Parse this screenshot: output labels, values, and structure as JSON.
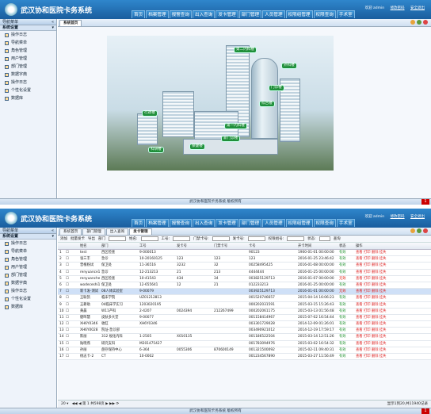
{
  "app": {
    "title": "武汉协和医院卡务系统"
  },
  "nav": [
    "首页",
    "档案管理",
    "报警查询",
    "出入查询",
    "发卡管理",
    "部门管理",
    "人员管理",
    "权限组管理",
    "权限查询",
    "手术室"
  ],
  "user": {
    "welcome": "欢迎 admin",
    "change_pwd": "修改密码",
    "logout": "安全退出"
  },
  "sidebar": {
    "header": "导航菜单",
    "collapse": "«",
    "section": "系统设置",
    "items": [
      "操作日志",
      "导航菜单",
      "角色管理",
      "用户管理",
      "部门管理",
      "数据字典",
      "操作日志",
      "个性化设置",
      "数据库"
    ]
  },
  "screen1": {
    "tabs": [
      "系统首页"
    ],
    "labels": [
      "第二内科楼",
      "外科楼",
      "门诊楼",
      "综合楼",
      "行政楼",
      "第一内科楼",
      "新门诊楼",
      "保健楼",
      "科研楼"
    ]
  },
  "screen2": {
    "tabs": [
      "系统首页",
      "部门管理",
      "出入查询",
      "发卡管理"
    ],
    "toolbar": {
      "add": "添加",
      "edit": "批量发卡",
      "export": "导出",
      "import": "部门",
      "name": "姓名:",
      "id": "工号:",
      "card": "门禁卡号:",
      "issue": "发卡号:",
      "group": "权限组号:",
      "status": "状态:",
      "search": "查询"
    },
    "columns": [
      "",
      "姓名",
      "部门",
      "工号",
      "发卡号",
      "门禁卡号",
      "卡号",
      "开卡时间",
      "状态",
      "操作"
    ],
    "rows": [
      [
        "1",
        "test",
        "西区检查",
        "9-000013",
        "",
        "",
        "90123",
        "1900-01-01 00:00:00",
        "有效"
      ],
      [
        "2",
        "张三丰",
        "急诊",
        "10-20160125",
        "123",
        "123",
        "123",
        "2016-01-25 23:46:42",
        "有效"
      ],
      [
        "3",
        "曾根粉试",
        "保卫处",
        "11-36516",
        "3232",
        "32",
        "00258495425",
        "2016-01-08 00:00:00",
        "有效"
      ],
      [
        "4",
        "renyuance1",
        "急诊",
        "12-213213",
        "21",
        "213",
        "4444444",
        "2016-01-25 00:00:00",
        "有效"
      ],
      [
        "5",
        "renyuancheshi",
        "西区检查",
        "10-41543",
        "434",
        "34",
        "003825129713",
        "2016-01-07 00:00:00",
        "无效"
      ],
      [
        "6",
        "wodeceshi1",
        "保卫处",
        "12-655641",
        "12",
        "21",
        "012233213",
        "2016-01-25 00:00:00",
        "有效"
      ],
      [
        "7",
        "新卡发-测试",
        "08人体实验室",
        "9-00079",
        "",
        "",
        "003925129713",
        "2016-01-01 00:00:00",
        "无效"
      ],
      [
        "8",
        "王联凯",
        "临床学院",
        "UZ01212813",
        "",
        "",
        "001520746657",
        "2015-04-14 16:06:23",
        "有效"
      ],
      [
        "9",
        "王耕助",
        "04临床学实习",
        "1203020195",
        "",
        "",
        "000202031591",
        "2015-03-15 15:26:43",
        "有效"
      ],
      [
        "10",
        "黄晨",
        "W11产科",
        "2-4207",
        "0024394",
        "212267499",
        "000202061175",
        "2015-03-13 01:56:48",
        "有效"
      ],
      [
        "11",
        "健晖慧",
        "皮肤多大堂",
        "9-00077",
        "",
        "",
        "001158414967",
        "2015-07-02 16:54:44",
        "有效"
      ],
      [
        "12",
        "XH6Y0346",
        "收缸",
        "XH6Y0346",
        "",
        "",
        "003301729028",
        "2014-12-09 01:26:01",
        "有效"
      ],
      [
        "13",
        "XH6Y0028",
        "院址-急诊部",
        "",
        "",
        "",
        "003490921012",
        "2014-12-19 17:59:17",
        "有效"
      ],
      [
        "14",
        "陈丽",
        "312 规化内科",
        "1-2505",
        "X010135",
        "",
        "001186522504",
        "2015-03-14 12:51:26",
        "有效"
      ],
      [
        "15",
        "陆晓燕",
        "研究支科",
        "M201475427",
        "",
        "",
        "001783094976",
        "2015-03-02 16:54:32",
        "有效"
      ],
      [
        "16",
        "孙丽",
        "盘存保持中心",
        "6-364",
        "0055306",
        "870600149",
        "001321500092",
        "2015-02-11 09:40:31",
        "有效"
      ],
      [
        "17",
        "杨志卡-2",
        "CT",
        "10-0002",
        "",
        "",
        "001234567890",
        "2015-03-27 11:56:49",
        "有效"
      ]
    ],
    "ops": "查看 打印 删除 挂失",
    "pager": {
      "size": "20",
      "page_label": "第",
      "page": "1",
      "total_pages": "共598页",
      "summary": "显示1到20,共11940记录"
    }
  },
  "footer": "武汉协和医院卡务系统 版权所有",
  "badge": "1"
}
